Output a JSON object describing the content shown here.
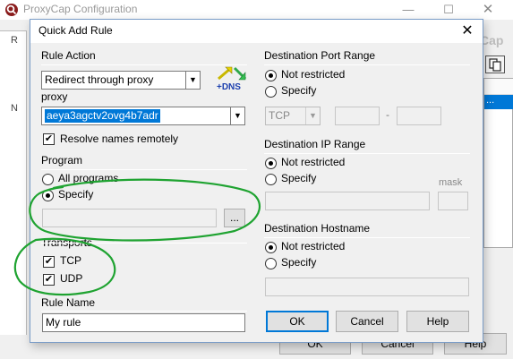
{
  "background_window": {
    "title": "ProxyCap Configuration",
    "title_controls": {
      "minimize": "—",
      "maximize": "☐",
      "close": "✕"
    },
    "left_pane_fragments": [
      "R",
      "N"
    ],
    "right_pane_title_fragment": "Cap",
    "buttons": {
      "ok": "OK",
      "cancel": "Cancel",
      "help": "Help"
    }
  },
  "dialog": {
    "title": "Quick Add Rule",
    "close_glyph": "✕",
    "rule_action": {
      "heading": "Rule Action",
      "selected": "Redirect through proxy",
      "proxy_label": "proxy",
      "proxy_selected": "aeya3agctv2ovg4b7adr",
      "dns_badge": "+DNS",
      "resolve_remotely": {
        "label": "Resolve names remotely",
        "checked": true
      }
    },
    "program": {
      "heading": "Program",
      "all_programs": {
        "label": "All programs",
        "selected": false
      },
      "specify": {
        "label": "Specify",
        "selected": true
      },
      "path_value": "",
      "browse_label": "..."
    },
    "transports": {
      "heading": "Transports",
      "tcp": {
        "label": "TCP",
        "checked": true
      },
      "udp": {
        "label": "UDP",
        "checked": true
      }
    },
    "rule_name": {
      "heading": "Rule Name",
      "value": "My rule"
    },
    "destination_port_range": {
      "heading": "Destination Port Range",
      "not_restricted": {
        "label": "Not restricted",
        "selected": true
      },
      "specify": {
        "label": "Specify",
        "selected": false
      },
      "protocol": "TCP",
      "port_from": "",
      "port_separator": "-",
      "port_to": ""
    },
    "destination_ip_range": {
      "heading": "Destination IP Range",
      "not_restricted": {
        "label": "Not restricted",
        "selected": true
      },
      "specify": {
        "label": "Specify",
        "selected": false
      },
      "ip_value": "",
      "mask_label": "mask",
      "mask_value": ""
    },
    "destination_hostname": {
      "heading": "Destination Hostname",
      "not_restricted": {
        "label": "Not restricted",
        "selected": true
      },
      "specify": {
        "label": "Specify",
        "selected": false
      },
      "hostname_value": ""
    },
    "buttons": {
      "ok": "OK",
      "cancel": "Cancel",
      "help": "Help"
    }
  },
  "colors": {
    "selection": "#0078d7",
    "annotation": "#1fa331",
    "dialog_bg": "#f0f0f0"
  }
}
